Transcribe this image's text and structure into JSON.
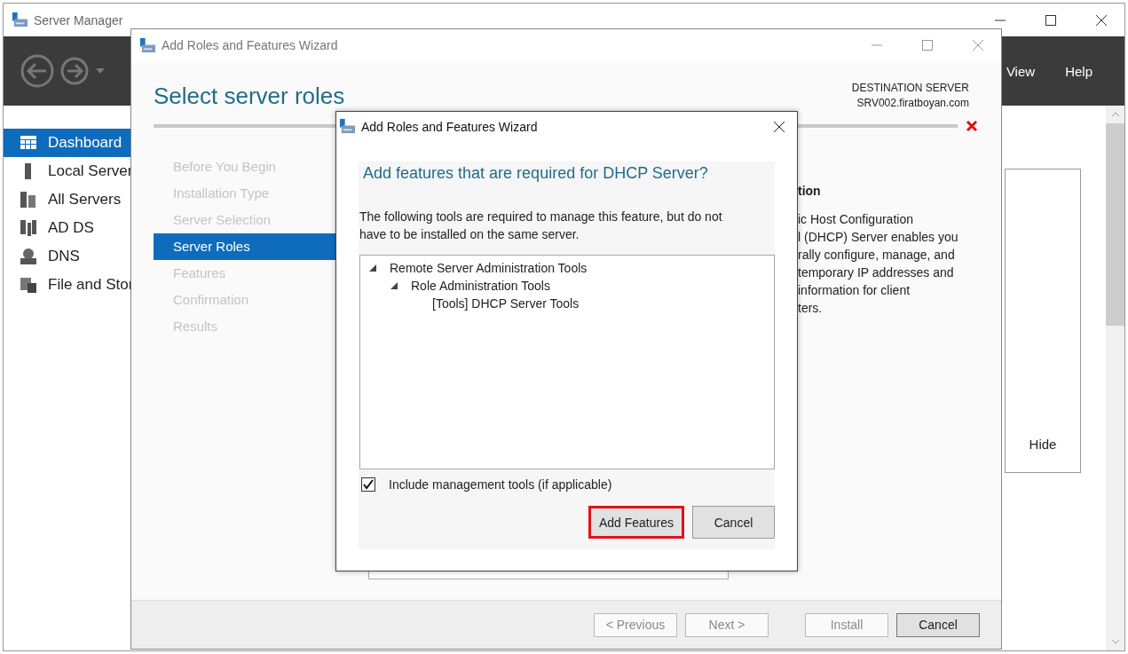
{
  "server_manager": {
    "title": "Server Manager",
    "menu": [
      "View",
      "Help"
    ],
    "sidebar": [
      {
        "label": "Dashboard",
        "kind": "dashboard",
        "selected": true
      },
      {
        "label": "Local Server",
        "kind": "server",
        "selected": false
      },
      {
        "label": "All Servers",
        "kind": "servers",
        "selected": false
      },
      {
        "label": "AD DS",
        "kind": "adds",
        "selected": false
      },
      {
        "label": "DNS",
        "kind": "dns",
        "selected": false
      },
      {
        "label": "File and Stor",
        "kind": "files",
        "selected": false
      }
    ],
    "hide_button": "Hide"
  },
  "wizard": {
    "title": "Add Roles and Features Wizard",
    "heading": "Select server roles",
    "destination_label": "DESTINATION SERVER",
    "destination_server": "SRV002.firatboyan.com",
    "steps": [
      {
        "label": "Before You Begin",
        "selected": false
      },
      {
        "label": "Installation Type",
        "selected": false
      },
      {
        "label": "Server Selection",
        "selected": false
      },
      {
        "label": "Server Roles",
        "selected": true
      },
      {
        "label": "Features",
        "selected": false
      },
      {
        "label": "Confirmation",
        "selected": false
      },
      {
        "label": "Results",
        "selected": false
      }
    ],
    "description_heading": "tion",
    "description_lines": [
      "ic Host Configuration",
      "l (DHCP) Server enables you",
      "rally configure, manage, and",
      "temporary IP addresses and",
      "information for client",
      "ters."
    ],
    "buttons": [
      {
        "label": "< Previous",
        "disabled": true
      },
      {
        "label": "Next >",
        "disabled": true
      },
      {
        "label": "Install",
        "disabled": true
      },
      {
        "label": "Cancel",
        "disabled": false
      }
    ]
  },
  "dialog": {
    "title": "Add Roles and Features Wizard",
    "heading": "Add features that are required for DHCP Server?",
    "message": "The following tools are required to manage this feature, but do not have to be installed on the same server.",
    "tree": [
      {
        "label": "Remote Server Administration Tools",
        "expanded": true,
        "children": [
          {
            "label": "Role Administration Tools",
            "expanded": true,
            "children": [
              {
                "label": "[Tools] DHCP Server Tools"
              }
            ]
          }
        ]
      }
    ],
    "include_tools": {
      "label": "Include management tools (if applicable)",
      "checked": true
    },
    "buttons": [
      {
        "label": "Add Features",
        "highlighted": true
      },
      {
        "label": "Cancel",
        "highlighted": false
      }
    ]
  }
}
